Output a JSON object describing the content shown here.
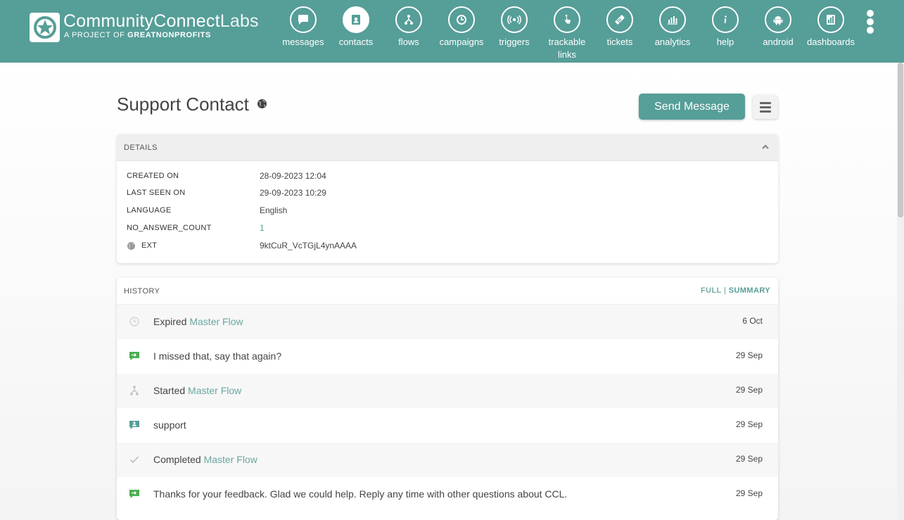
{
  "brand": {
    "title_strong": "CommunityConnect",
    "title_light": "Labs",
    "subtitle_prefix": "A PROJECT OF",
    "subtitle_org": "GREATNONPROFITS"
  },
  "nav": {
    "items": [
      {
        "label": "messages"
      },
      {
        "label": "contacts"
      },
      {
        "label": "flows"
      },
      {
        "label": "campaigns"
      },
      {
        "label": "triggers"
      },
      {
        "label": "trackable links"
      },
      {
        "label": "tickets"
      },
      {
        "label": "analytics"
      },
      {
        "label": "help"
      },
      {
        "label": "android"
      },
      {
        "label": "dashboards"
      }
    ]
  },
  "contact": {
    "title": "Support Contact",
    "send_label": "Send Message"
  },
  "details": {
    "header": "DETAILS",
    "rows": [
      {
        "key": "CREATED ON",
        "value": "28-09-2023 12:04"
      },
      {
        "key": "LAST SEEN ON",
        "value": "29-09-2023 10:29"
      },
      {
        "key": "LANGUAGE",
        "value": "English"
      },
      {
        "key": "NO_ANSWER_COUNT",
        "value": "1"
      },
      {
        "key": "EXT",
        "value": "9ktCuR_VcTGjL4ynAAAA"
      }
    ]
  },
  "history": {
    "header": "HISTORY",
    "full_label": "FULL",
    "separator": "|",
    "summary_label": "SUMMARY",
    "events": [
      {
        "text": "Expired",
        "link": "Master Flow",
        "date": "6 Oct",
        "icon": "clock-icon"
      },
      {
        "text": "I missed that, say that again?",
        "link": "",
        "date": "29 Sep",
        "icon": "outgoing-message-icon"
      },
      {
        "text": "Started",
        "link": "Master Flow",
        "date": "29 Sep",
        "icon": "flow-icon"
      },
      {
        "text": "support",
        "link": "",
        "date": "29 Sep",
        "icon": "incoming-message-icon"
      },
      {
        "text": "Completed",
        "link": "Master Flow",
        "date": "29 Sep",
        "icon": "check-icon"
      },
      {
        "text": "Thanks for your feedback. Glad we could help. Reply any time with other questions about CCL.",
        "link": "",
        "date": "29 Sep",
        "icon": "outgoing-message-icon"
      }
    ]
  },
  "colors": {
    "primary": "#569e98",
    "message_green": "#4caf50"
  }
}
